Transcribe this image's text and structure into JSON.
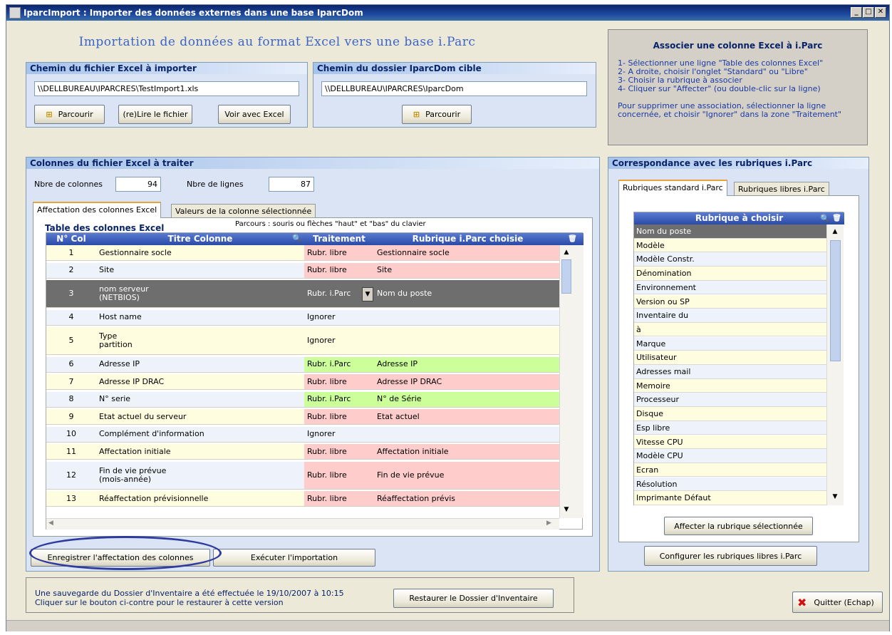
{
  "window": {
    "title": "IparcImport : Importer des données externes dans une base IparcDom",
    "min": "_",
    "max": "□",
    "close": "✕"
  },
  "main_title": "Importation de données au format Excel vers une base i.Parc",
  "excel_path": {
    "title": "Chemin du fichier Excel à importer",
    "value": "\\\\DELLBUREAU\\IPARCRES\\TestImport1.xls",
    "browse": "Parcourir",
    "reload": "(re)Lire le fichier",
    "view": "Voir avec Excel"
  },
  "target_path": {
    "title": "Chemin du dossier IparcDom cible",
    "value": "\\\\DELLBUREAU\\IPARCRES\\IparcDom",
    "browse": "Parcourir"
  },
  "help": {
    "title": "Associer une colonne Excel à i.Parc",
    "lines": [
      "1- Sélectionner une ligne \"Table des colonnes Excel\"",
      "2- A droite, choisir l'onglet \"Standard\" ou \"Libre\"",
      "3- Choisir la rubrique à associer",
      "4- Cliquer sur \"Affecter\" (ou double-clic sur la ligne)",
      "",
      "Pour supprimer une association, sélectionner la ligne",
      "concernée, et choisir \"Ignorer\" dans la zone \"Traitement\""
    ]
  },
  "columns_group": {
    "title": "Colonnes du fichier Excel à traiter",
    "ncols_label": "Nbre de colonnes",
    "ncols": "94",
    "nrows_label": "Nbre de lignes",
    "nrows": "87",
    "tab1": "Affectation des colonnes Excel",
    "tab2": "Valeurs de la colonne sélectionnée",
    "table_title": "Table des colonnes Excel",
    "nav_hint": "Parcours : souris ou flèches \"haut\" et \"bas\" du clavier",
    "headers": [
      "N° Col",
      "Titre Colonne",
      "Traitement",
      "Rubrique i.Parc choisie"
    ]
  },
  "rows": [
    {
      "n": "1",
      "title": "Gestionnaire socle",
      "treat": "Rubr. libre",
      "rub": "Gestionnaire socle",
      "kind": "libre"
    },
    {
      "n": "2",
      "title": "Site",
      "treat": "Rubr. libre",
      "rub": "Site",
      "kind": "libre"
    },
    {
      "n": "3",
      "title": "nom serveur\n(NETBIOS)",
      "treat": "Rubr. i.Parc",
      "rub": "Nom du poste",
      "kind": "selected"
    },
    {
      "n": "4",
      "title": "Host name",
      "treat": "Ignorer",
      "rub": "",
      "kind": "ignore"
    },
    {
      "n": "5",
      "title": "Type\npartition",
      "treat": "Ignorer",
      "rub": "",
      "kind": "ignore"
    },
    {
      "n": "6",
      "title": "Adresse IP",
      "treat": "Rubr. i.Parc",
      "rub": "Adresse IP",
      "kind": "iparc"
    },
    {
      "n": "7",
      "title": "Adresse IP DRAC",
      "treat": "Rubr. libre",
      "rub": "Adresse IP DRAC",
      "kind": "libre"
    },
    {
      "n": "8",
      "title": "N° serie",
      "treat": "Rubr. i.Parc",
      "rub": "N° de Série",
      "kind": "iparc"
    },
    {
      "n": "9",
      "title": "Etat actuel du serveur",
      "treat": "Rubr. libre",
      "rub": "Etat actuel",
      "kind": "libre"
    },
    {
      "n": "10",
      "title": "Complément d'information",
      "treat": "Ignorer",
      "rub": "",
      "kind": "ignore"
    },
    {
      "n": "11",
      "title": "Affectation initiale",
      "treat": "Rubr. libre",
      "rub": "Affectation initiale",
      "kind": "libre"
    },
    {
      "n": "12",
      "title": "Fin de vie prévue\n(mois-année)",
      "treat": "Rubr. libre",
      "rub": "Fin de vie prévue",
      "kind": "libre"
    },
    {
      "n": "13",
      "title": "Réaffectation prévisionnelle",
      "treat": "Rubr. libre",
      "rub": "Réaffectation prévis",
      "kind": "libre"
    }
  ],
  "bottom_buttons": {
    "save": "Enregistrer l'affectation des colonnes",
    "run": "Exécuter l'importation"
  },
  "backup": {
    "line1": "Une sauvegarde du Dossier d'Inventaire a été effectuée le 19/10/2007 à 10:15",
    "line2": "Cliquer sur le bouton ci-contre pour le restaurer à cette version",
    "restore": "Restaurer le Dossier d'Inventaire"
  },
  "quit": "Quitter (Echap)",
  "rubriques": {
    "title": "Correspondance avec les rubriques i.Parc",
    "tab1": "Rubriques standard i.Parc",
    "tab2": "Rubriques libres i.Parc",
    "header": "Rubrique à choisir",
    "items": [
      "Nom du poste",
      "Modèle",
      "Modèle Constr.",
      "Dénomination",
      "Environnement",
      "Version ou SP",
      "Inventaire du",
      "à",
      "Marque",
      "Utilisateur",
      "Adresses mail",
      "Memoire",
      "Processeur",
      "Disque",
      "Esp libre",
      "Vitesse CPU",
      "Modèle CPU",
      "Ecran",
      "Résolution",
      "Imprimante Défaut"
    ],
    "assign": "Affecter la rubrique sélectionnée",
    "configure": "Configurer les rubriques libres i.Parc"
  },
  "colors": {
    "libre": "#ffcccc",
    "iparc": "#ccff99",
    "selected": "#6e6e6e",
    "rowA": "#fffde0",
    "rowB": "#eef3fb",
    "accent": "#3b64c8"
  }
}
